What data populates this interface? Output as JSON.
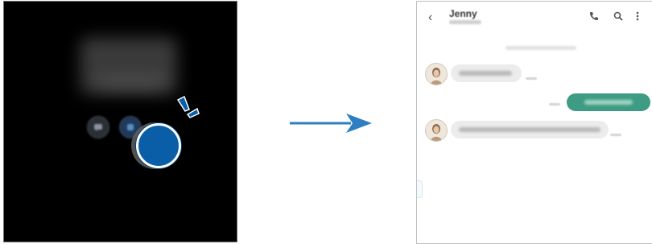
{
  "lockscreen": {
    "notification_icons": [
      "messages-icon",
      "app-icon"
    ]
  },
  "arrow": {
    "direction": "right",
    "color": "#2d7fc1"
  },
  "chat": {
    "contact_name": "Jenny",
    "header_icons": [
      "back-icon",
      "phone-icon",
      "search-icon",
      "more-icon"
    ],
    "accent_color": "#3e9c84"
  }
}
